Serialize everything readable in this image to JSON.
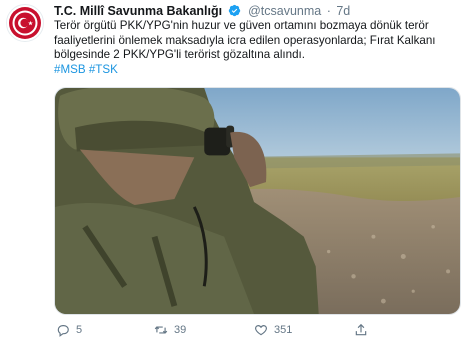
{
  "tweet": {
    "author_name": "T.C. Millî Savunma Bakanlığı",
    "handle": "@tcsavunma",
    "separator": "·",
    "time": "7d",
    "text_lines": [
      "Terör örgütü PKK/YPG'nin huzur ve güven ortamını bozmaya dönük terör",
      "faaliyetlerini önlemek maksadıyla icra edilen operasyonlarda; Fırat Kalkanı",
      "bölgesinde 2 PKK/YPG'li terörist gözaltına alındı."
    ],
    "hashtags": [
      "#MSB",
      "#TSK"
    ]
  },
  "actions": {
    "reply_count": "5",
    "retweet_count": "39",
    "like_count": "351"
  },
  "colors": {
    "accent": "#1b95e0",
    "muted": "#657786",
    "text": "#14171a"
  },
  "icons": {
    "verified": "verified-badge-icon",
    "reply": "reply-icon",
    "retweet": "retweet-icon",
    "like": "heart-icon",
    "share": "share-icon"
  }
}
